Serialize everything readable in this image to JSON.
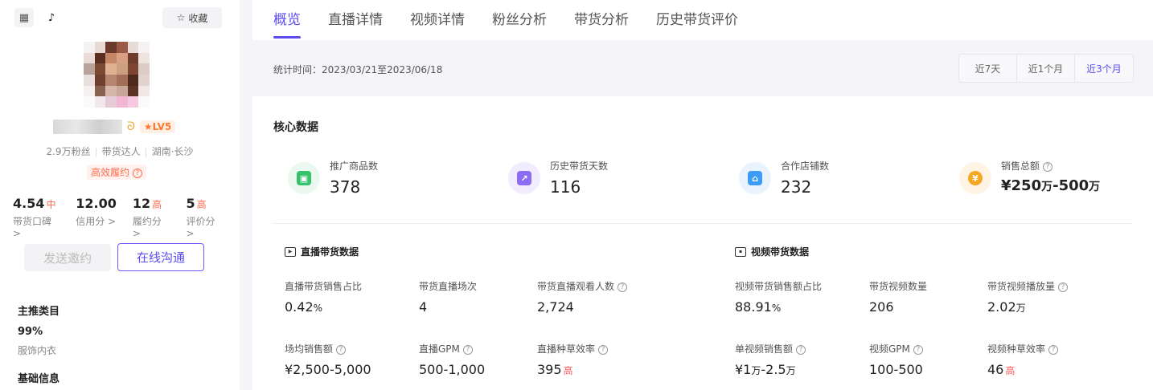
{
  "sidebar": {
    "favorite_label": "收藏",
    "level": "LV5",
    "meta": [
      "2.9万粉丝",
      "带货达人",
      "湖南·长沙"
    ],
    "performance_badge": "高效履约",
    "scores": [
      {
        "value": "4.54",
        "level": "中",
        "label": "带货口碑"
      },
      {
        "value": "12.00",
        "level": "",
        "label": "信用分"
      },
      {
        "value": "12",
        "level": "高",
        "label": "履约分"
      },
      {
        "value": "5",
        "level": "高",
        "label": "评价分"
      }
    ],
    "invite_label": "发送邀约",
    "chat_label": "在线沟通",
    "main_category_title": "主推类目",
    "main_category_percent": "99%",
    "main_category_name": "服饰内衣",
    "basic_info_title": "基础信息"
  },
  "tabs": [
    "概览",
    "直播详情",
    "视频详情",
    "粉丝分析",
    "带货分析",
    "历史带货评价"
  ],
  "stats": {
    "label": "统计时间：2023/03/21至2023/06/18",
    "ranges": [
      "近7天",
      "近1个月",
      "近3个月"
    ]
  },
  "core": {
    "title": "核心数据",
    "kpis": [
      {
        "label": "推广商品数",
        "value": "378",
        "color": "#36c26b",
        "bg": "#eaf8ef",
        "icon": "bag-icon"
      },
      {
        "label": "历史带货天数",
        "value": "116",
        "color": "#8a6cf5",
        "bg": "#f1edfe",
        "icon": "chart-icon"
      },
      {
        "label": "合作店铺数",
        "value": "232",
        "color": "#3d9cf5",
        "bg": "#e9f3fe",
        "icon": "store-icon"
      },
      {
        "label": "销售总额",
        "value_a": "¥250",
        "unit_a": "万",
        "value_b": "-500",
        "unit_b": "万",
        "color": "#f5a623",
        "bg": "#fff4e3",
        "icon": "coin-icon"
      }
    ]
  },
  "live": {
    "title": "直播带货数据",
    "metrics": [
      {
        "label": "直播带货销售占比",
        "value": "0.42",
        "unit": "%"
      },
      {
        "label": "带货直播场次",
        "value": "4"
      },
      {
        "label": "带货直播观看人数",
        "value": "2,724"
      },
      {
        "label": "场均销售额",
        "value": "¥2,500-5,000"
      },
      {
        "label": "直播GPM",
        "value": "500-1,000"
      },
      {
        "label": "直播种草效率",
        "value": "395",
        "level": "高"
      }
    ]
  },
  "video": {
    "title": "视频带货数据",
    "metrics": [
      {
        "label": "视频带货销售额占比",
        "value": "88.91",
        "unit": "%"
      },
      {
        "label": "带货视频数量",
        "value": "206"
      },
      {
        "label": "带货视频播放量",
        "value": "2.02",
        "unit": "万"
      },
      {
        "label": "单视频销售额",
        "value_a": "¥1",
        "unit_a": "万",
        "value_b": "-2.5",
        "unit_b": "万"
      },
      {
        "label": "视频GPM",
        "value": "100-500"
      },
      {
        "label": "视频种草效率",
        "value": "46",
        "level": "高"
      }
    ]
  }
}
